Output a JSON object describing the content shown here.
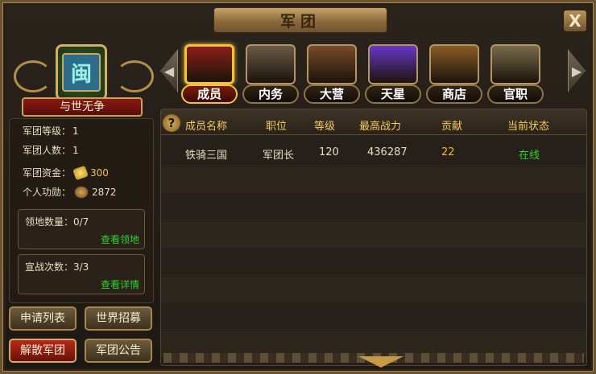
{
  "window": {
    "title": "军团",
    "close_label": "X"
  },
  "legion": {
    "emblem_char": "闽",
    "name": "与世无争",
    "stats": {
      "level_label": "军团等级：",
      "level_value": "1",
      "members_label": "军团人数：",
      "members_value": "1",
      "funds_label": "军团资金：",
      "funds_value": "300",
      "merit_label": "个人功勋：",
      "merit_value": "2872"
    },
    "territory": {
      "label": "领地数量：0/7",
      "link": "查看领地"
    },
    "war": {
      "label": "宣战次数：3/3",
      "link": "查看详情"
    }
  },
  "buttons": {
    "apply_list": "申请列表",
    "world_recruit": "世界招募",
    "disband": "解散军团",
    "announcement": "军团公告"
  },
  "tabs": [
    {
      "label": "成员",
      "active": true,
      "color": "#8a1e18"
    },
    {
      "label": "内务",
      "active": false,
      "color": "#6a5a44"
    },
    {
      "label": "大营",
      "active": false,
      "color": "#7a4a2a"
    },
    {
      "label": "天星",
      "active": false,
      "color": "#6a36c8"
    },
    {
      "label": "商店",
      "active": false,
      "color": "#8a5a24"
    },
    {
      "label": "官职",
      "active": false,
      "color": "#7a6a4a"
    }
  ],
  "table": {
    "headers": [
      "成员名称",
      "职位",
      "等级",
      "最高战力",
      "贡献",
      "当前状态"
    ],
    "rows": [
      [
        "铁骑三国",
        "军团长",
        "120",
        "436287",
        "22",
        "在线"
      ]
    ]
  },
  "colors": {
    "accent_gold": "#f5ca62",
    "online_green": "#2fd12f",
    "contribution_orange": "#f5b831"
  }
}
